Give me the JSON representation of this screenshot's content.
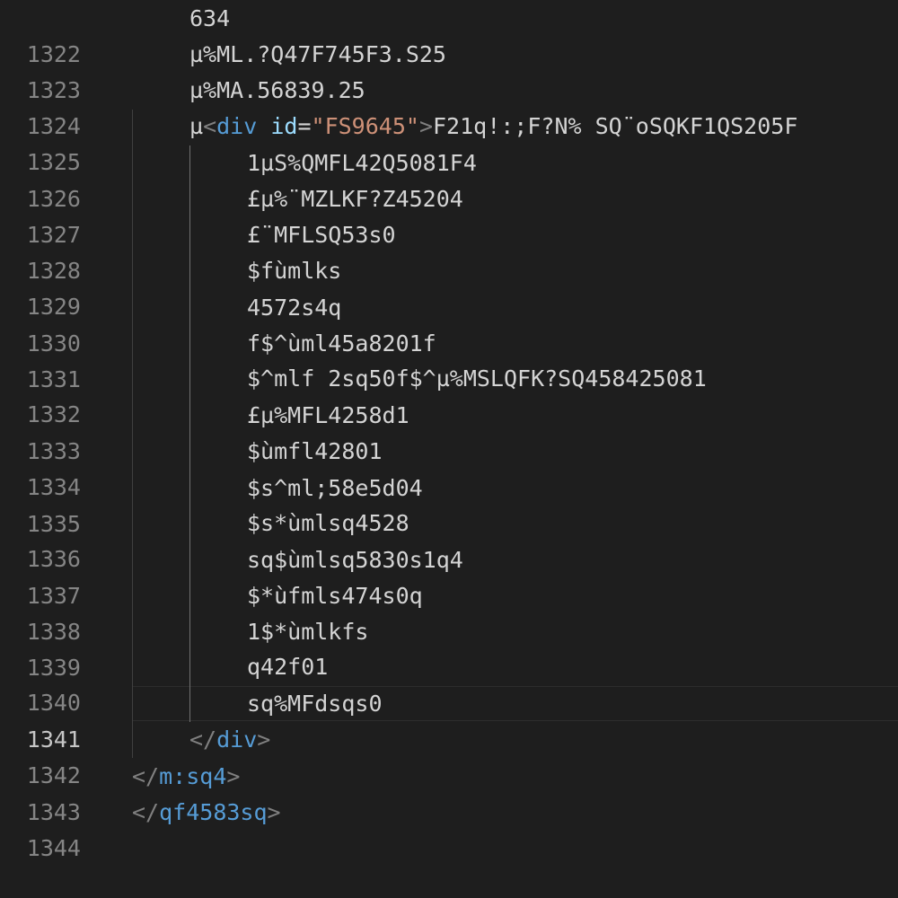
{
  "editor": {
    "lines": [
      {
        "number": "1322",
        "text": "634"
      },
      {
        "number": "1323",
        "text": "µ%ML.?Q47F745F3.S25"
      },
      {
        "number": "1324",
        "text": "µ%MA.56839.25"
      },
      {
        "number": "1325",
        "prefix": "µ",
        "tag_open": "<",
        "tag_name": "div",
        "attr_name": "id",
        "attr_eq": "=",
        "attr_value": "\"FS9645\"",
        "tag_close": ">",
        "suffix": "F21q!:;F?N% SQ¨oSQKF1QS205F"
      },
      {
        "number": "1326",
        "text": "1µS%QMFL42Q5081F4"
      },
      {
        "number": "1327",
        "text": "£µ%¨MZLKF?Z45204"
      },
      {
        "number": "1328",
        "text": "£¨MFLSQ53s0"
      },
      {
        "number": "1329",
        "text": "$fùmlks"
      },
      {
        "number": "1330",
        "text": "4572s4q"
      },
      {
        "number": "1331",
        "text": "f$^ùml45a8201f"
      },
      {
        "number": "1332",
        "text": "$^mlf 2sq50f$^µ%MSLQFK?SQ458425081"
      },
      {
        "number": "1333",
        "text": "£µ%MFL4258d1"
      },
      {
        "number": "1334",
        "text": "$ùmfl42801"
      },
      {
        "number": "1335",
        "text": "$s^ml;58e5d04"
      },
      {
        "number": "1336",
        "text": "$s*ùmlsq4528"
      },
      {
        "number": "1337",
        "text": "sq$ùmlsq5830s1q4"
      },
      {
        "number": "1338",
        "text": "$*ùfmls474s0q"
      },
      {
        "number": "1339",
        "text": "1$*ùmlkfs"
      },
      {
        "number": "1340",
        "text": "q42f01"
      },
      {
        "number": "1341",
        "text": "sq%MFdsqs0"
      },
      {
        "number": "1342",
        "close_open": "</",
        "close_name": "div",
        "close_end": ">"
      },
      {
        "number": "1343",
        "close_open": "</",
        "close_name": "m:sq4",
        "close_end": ">"
      },
      {
        "number": "1344",
        "close_open": "</",
        "close_name": "qf4583sq",
        "close_end": ">"
      }
    ]
  },
  "colors": {
    "background": "#1e1e1e",
    "line_number": "#858585",
    "active_line_number": "#c6c6c6",
    "text": "#d4d4d4",
    "tag_bracket": "#808080",
    "tag_name": "#569cd6",
    "attribute_name": "#9cdcfe",
    "attribute_value": "#ce9178"
  }
}
